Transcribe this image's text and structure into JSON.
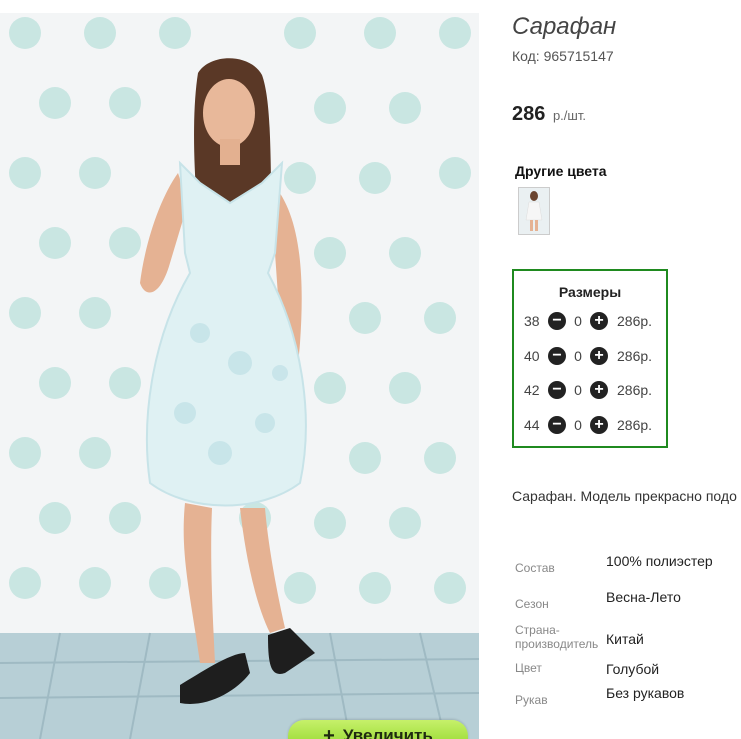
{
  "product": {
    "title": "Сарафан",
    "code": "Код: 965715147",
    "price": "286",
    "price_unit": "р./шт."
  },
  "zoom_button": {
    "label": "Увеличить",
    "icon": "plus-icon"
  },
  "other_colors": {
    "title": "Другие цвета",
    "thumbs": [
      "color-variant-thumbnail"
    ]
  },
  "sizes": {
    "title": "Размеры",
    "rows": [
      {
        "size": "38",
        "qty": "0",
        "price": "286р."
      },
      {
        "size": "40",
        "qty": "0",
        "price": "286р."
      },
      {
        "size": "42",
        "qty": "0",
        "price": "286р."
      },
      {
        "size": "44",
        "qty": "0",
        "price": "286р."
      }
    ]
  },
  "description": "Сарафан. Модель прекрасно подо",
  "properties": [
    {
      "key": "Состав",
      "value": "100% полиэстер"
    },
    {
      "key": "Сезон",
      "value": "Весна-Лето"
    },
    {
      "key": "Страна-производитель",
      "value": "Китай"
    },
    {
      "key": "Цвет",
      "value": "Голубой"
    },
    {
      "key": "Рукав",
      "value": "Без рукавов"
    }
  ],
  "colors": {
    "accent_border": "#1f8a1f",
    "zoom_button": "#a6e03c",
    "dots": "#c9e6e2"
  }
}
